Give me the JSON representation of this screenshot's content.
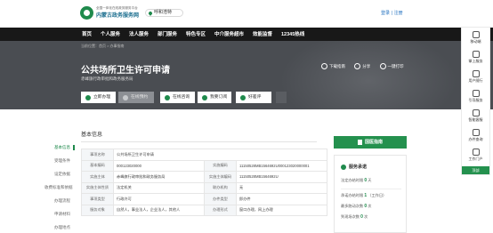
{
  "header": {
    "logo_subtitle": "全国一体化在线政务服务平台",
    "logo_title": "内蒙古政务服务网",
    "region": "呼和浩特",
    "login": "登录",
    "register": "注册"
  },
  "nav": {
    "items": [
      "首页",
      "个人服务",
      "法人服务",
      "部门服务",
      "特色专区",
      "中介服务超市",
      "效能监督",
      "12345热线"
    ]
  },
  "breadcrumb": "当前位置：首页 > 办事指南",
  "hero": {
    "title": "公共场所卫生许可申请",
    "org": "赤峰旗行政审批和政务服务局",
    "tools": {
      "download": "下载指南",
      "share": "分享",
      "one_thing": "一键打印"
    },
    "buttons": [
      "立即办理",
      "在线预约",
      "在线咨询",
      "我要订阅",
      "好差评"
    ]
  },
  "section": {
    "title": "基本信息"
  },
  "side_menu": [
    "基本信息",
    "受理条件",
    "设定依据",
    "收费标准和依据",
    "办理流程",
    "申请材料",
    "办理地点"
  ],
  "info_table": [
    [
      "事项名称",
      "公共场所卫生许可申请",
      "",
      ""
    ],
    [
      "基本编码",
      "000123020000",
      "实施编码",
      "11150528MB1564692U000123020000001"
    ],
    [
      "实施主体",
      "赤峰旗行政审批和政务服务局",
      "实施主体编码",
      "11150528MB1564692U"
    ],
    [
      "实施主体性质",
      "法定机关",
      "联办机构",
      "无"
    ],
    [
      "事项类型",
      "行政许可",
      "办件类型",
      "即办件"
    ],
    [
      "服务对象",
      "自然人，事业法人，企业法人，其他人",
      "办理形式",
      "窗口办理，网上办理"
    ]
  ],
  "sidebar": {
    "guide_button": "国医指南",
    "service_title": "服务承诺",
    "legal_limit_label": "法定办结时限",
    "legal_limit_value": "0",
    "legal_limit_unit": "天",
    "promise_label": "承诺办结时限",
    "promise_value": "1",
    "promise_unit": "（工作日）",
    "visit_label": "最多跑动次数",
    "visit_value": "0",
    "visit_unit": "次",
    "online_label": "到现场次数",
    "online_value": "0",
    "online_unit": "次"
  },
  "dock": {
    "items": [
      "移动端",
      "掌上服务",
      "用户随行",
      "引导服务",
      "智能客服",
      "办件查询",
      "工作门户"
    ],
    "back_top": "顶部"
  },
  "colors": {
    "brand": "#1f8a4c",
    "nav_bg": "#181818",
    "hero_bg": "#4a4d52"
  }
}
